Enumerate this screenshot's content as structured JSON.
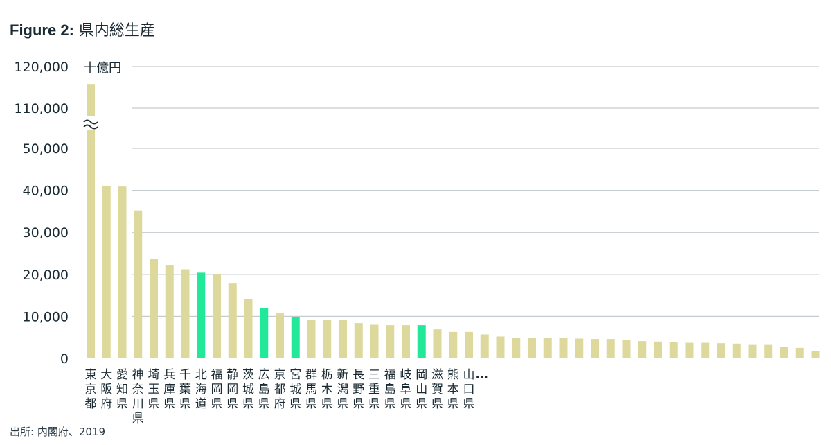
{
  "title": {
    "lead": "Figure 2:",
    "main": "県内総生産"
  },
  "source": "出所: 内閣府、2019",
  "colors": {
    "default_bar": "#ddd89b",
    "highlight_bar": "#22e89a",
    "grid": "#c5ccd0",
    "text": "#1a2a33"
  },
  "chart_data": {
    "type": "bar",
    "title": "県内総生産",
    "unit_label": "十億円",
    "xlabel": "",
    "ylabel": "",
    "y_axis_break": true,
    "y_ticks": [
      "0",
      "10,000",
      "20,000",
      "30,000",
      "40,000",
      "50,000",
      "110,000",
      "120,000"
    ],
    "ylim": [
      0,
      120000
    ],
    "grid": true,
    "truncation_label": "…",
    "categories": [
      "東京都",
      "大阪府",
      "愛知県",
      "神奈川県",
      "埼玉県",
      "兵庫県",
      "千葉県",
      "北海道",
      "福岡県",
      "静岡県",
      "茨城県",
      "広島県",
      "京都府",
      "宮城県",
      "群馬県",
      "栃木県",
      "新潟県",
      "長野県",
      "三重県",
      "福島県",
      "岐阜県",
      "岡山県",
      "滋賀県",
      "熊本県",
      "山口県",
      "",
      "",
      "",
      "",
      "",
      "",
      "",
      "",
      "",
      "",
      "",
      "",
      "",
      "",
      "",
      "",
      "",
      ""
    ],
    "values": [
      115800,
      41100,
      40900,
      35200,
      23600,
      22100,
      21200,
      20400,
      20000,
      17800,
      14100,
      12000,
      10700,
      9900,
      9200,
      9200,
      9100,
      8400,
      8000,
      7900,
      7900,
      7900,
      6900,
      6300,
      6300,
      5700,
      5200,
      4900,
      4900,
      4900,
      4800,
      4700,
      4600,
      4600,
      4400,
      4100,
      4000,
      3800,
      3700,
      3700,
      3600,
      3500,
      3200,
      3200,
      2700,
      2500,
      1800
    ],
    "highlighted": [
      "北海道",
      "広島県",
      "宮城県",
      "岡山県"
    ]
  }
}
